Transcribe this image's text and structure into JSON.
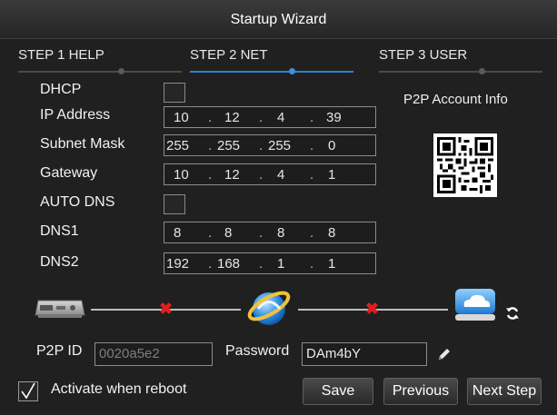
{
  "window": {
    "title": "Startup Wizard"
  },
  "steps": [
    {
      "label": "STEP 1 HELP"
    },
    {
      "label": "STEP 2 NET"
    },
    {
      "label": "STEP 3 USER"
    }
  ],
  "current_step": 2,
  "form": {
    "dhcp": {
      "label": "DHCP",
      "checked": false
    },
    "ip_address": {
      "label": "IP Address",
      "octets": [
        "10",
        "12",
        "4",
        "39"
      ]
    },
    "subnet_mask": {
      "label": "Subnet Mask",
      "octets": [
        "255",
        "255",
        "255",
        "0"
      ]
    },
    "gateway": {
      "label": "Gateway",
      "octets": [
        "10",
        "12",
        "4",
        "1"
      ]
    },
    "auto_dns": {
      "label": "AUTO DNS",
      "checked": false
    },
    "dns1": {
      "label": "DNS1",
      "octets": [
        "8",
        "8",
        "8",
        "8"
      ]
    },
    "dns2": {
      "label": "DNS2",
      "octets": [
        "192",
        "168",
        "1",
        "1"
      ]
    }
  },
  "p2p": {
    "title": "P2P Account Info",
    "id_label": "P2P ID",
    "id_value": "0020a5e2",
    "password_label": "Password",
    "password_value": "DAm4bY"
  },
  "network_status": {
    "devices": [
      "dvr-icon",
      "internet-icon",
      "cloud-icon"
    ],
    "links": [
      "disconnected",
      "disconnected"
    ]
  },
  "footer": {
    "activate_label": "Activate when reboot",
    "activate_checked": true,
    "save_label": "Save",
    "previous_label": "Previous",
    "next_label": "Next Step"
  },
  "colors": {
    "accent": "#2f7fd0",
    "error": "#e01e1e",
    "background": "#202020"
  }
}
